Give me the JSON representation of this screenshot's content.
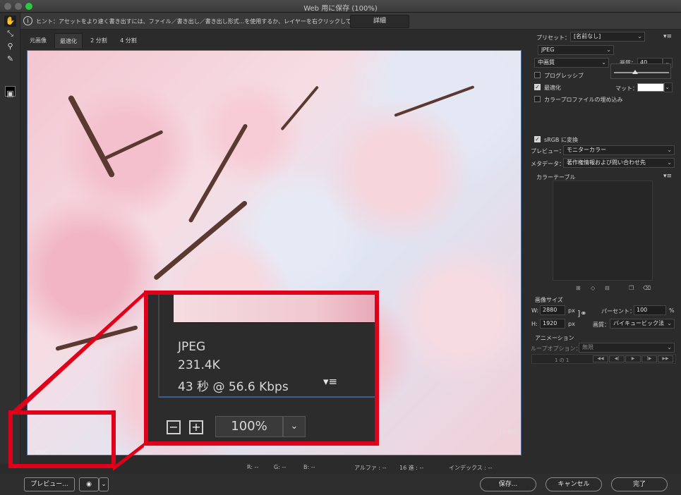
{
  "window": {
    "title": "Web 用に保存 (100%)"
  },
  "hint": {
    "text": "ヒント：アセットをより速く書き出すには、ファイル／書き出し／書き出し形式...を使用するか、レイヤーを右クリックして使用。",
    "detail_label": "詳細"
  },
  "tabs": [
    {
      "label": "元画像"
    },
    {
      "label": "最適化"
    },
    {
      "label": "2 分割"
    },
    {
      "label": "4 分割"
    }
  ],
  "preview": {
    "format": "JPEG",
    "size": "231.4K",
    "speed": "43 秒 @ 56.6 Kbps",
    "quality_label": "40 画質",
    "zoom": "100%"
  },
  "status": {
    "r": "R: --",
    "g": "G: --",
    "b": "B: --",
    "alpha": "アルファ : --",
    "hex": "16 進 : --",
    "index": "インデックス : --"
  },
  "footer": {
    "preview_label": "プレビュー...",
    "save_label": "保存...",
    "cancel_label": "キャンセル",
    "done_label": "完了"
  },
  "panel": {
    "preset_label": "プリセット：",
    "preset_value": "[名前なし]",
    "format_value": "JPEG",
    "quality_preset": "中画質",
    "quality_label": "画質：",
    "quality_value": "40",
    "progressive_label": "プログレッシブ",
    "optimize_label": "最適化",
    "matte_label": "マット：",
    "embed_profile_label": "カラープロファイルの埋め込み",
    "srgb_label": "sRGB に変換",
    "preview_label": "プレビュー：",
    "preview_value": "モニターカラー",
    "metadata_label": "メタデータ：",
    "metadata_value": "著作権情報および問い合わせ先",
    "color_table_label": "カラーテーブル",
    "image_size_label": "画像サイズ",
    "w_label": "W:",
    "w_value": "2880",
    "h_label": "H:",
    "h_value": "1920",
    "px": "px",
    "percent_label": "パーセント：",
    "percent_value": "100",
    "percent_unit": "%",
    "resample_label": "画質：",
    "resample_value": "バイキュービック法",
    "animation_label": "アニメーション",
    "loop_label": "ループオプション：",
    "loop_value": "無限",
    "frame_counter": "1 の 1"
  },
  "colors": {
    "highlight_red": "#e0001a",
    "accent_blue": "#4a6a98"
  }
}
